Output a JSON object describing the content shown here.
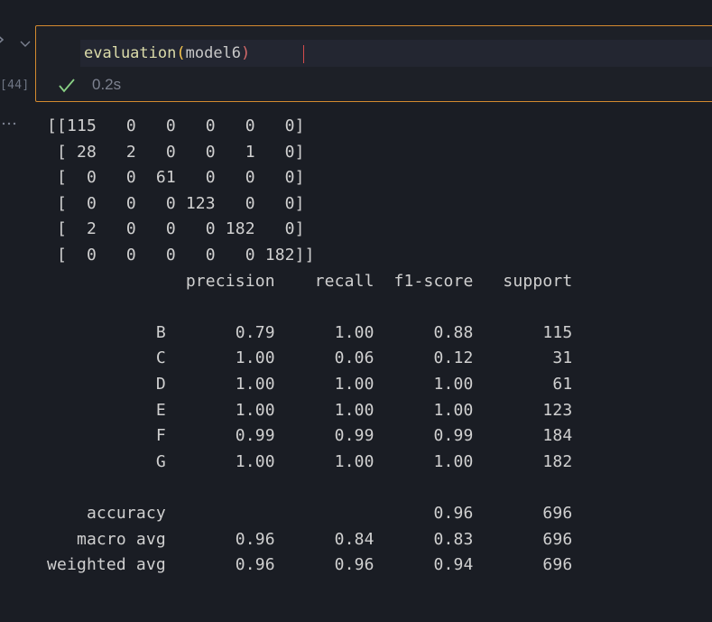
{
  "gutter": {
    "execution_count": "[44]",
    "run_icon": "run-arrow-icon",
    "collapse_icon": "chevron-down-icon",
    "output_menu_icon": "ellipsis-icon"
  },
  "cell": {
    "code": {
      "function": "evaluation",
      "open_paren": "(",
      "argument": "model6",
      "close_paren": ")"
    },
    "status": {
      "icon": "checkmark-icon",
      "time": "0.2s"
    }
  },
  "output_text": "[[115   0   0   0   0   0]\n [ 28   2   0   0   1   0]\n [  0   0  61   0   0   0]\n [  0   0   0 123   0   0]\n [  2   0   0   0 182   0]\n [  0   0   0   0   0 182]]\n              precision    recall  f1-score   support\n\n           B       0.79      1.00      0.88       115\n           C       1.00      0.06      0.12        31\n           D       1.00      1.00      1.00        61\n           E       1.00      1.00      1.00       123\n           F       0.99      0.99      0.99       184\n           G       1.00      1.00      1.00       182\n\n    accuracy                           0.96       696\n   macro avg       0.96      0.84      0.83       696\nweighted avg       0.96      0.96      0.94       696",
  "colors": {
    "background": "#1a1d24",
    "cell_border": "#d48a2f",
    "function": "#dcdcaa",
    "bracket": "#f9c74f",
    "success": "#89d185"
  }
}
